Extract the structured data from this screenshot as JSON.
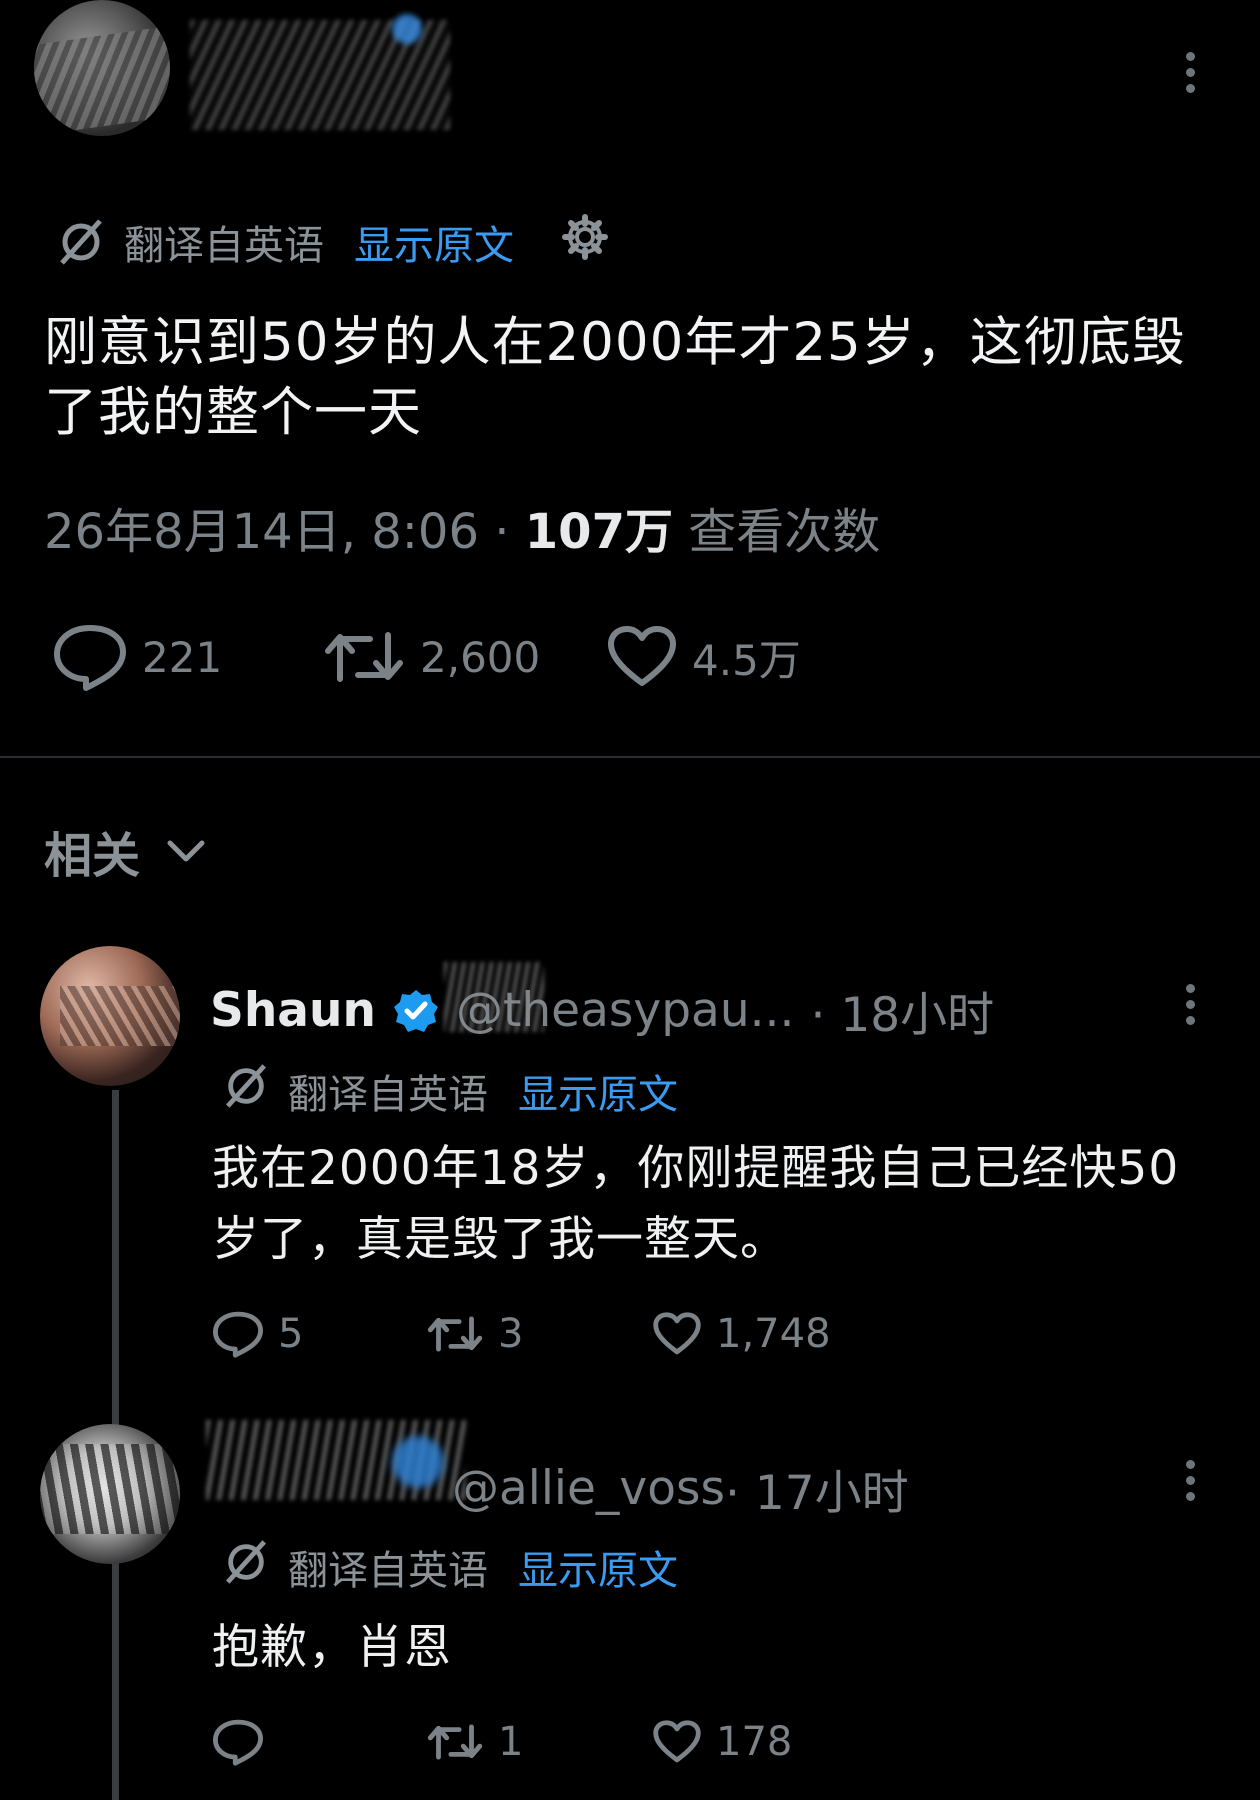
{
  "main_tweet": {
    "translate_label": "翻译自英语",
    "show_original": "显示原文",
    "text": "刚意识到50岁的人在2000年才25岁，这彻底毁了我的整个一天",
    "timestamp": "26年8月14日, 8:06 · ",
    "views_count": "107万",
    "views_label": " 查看次数",
    "replies": "221",
    "retweets": "2,600",
    "likes": "4.5万"
  },
  "related_label": "相关",
  "replies": [
    {
      "name": "Shaun",
      "handle": "@theasypau...",
      "time": " · 18小时",
      "translate_label": "翻译自英语",
      "show_original": "显示原文",
      "text": "我在2000年18岁，你刚提醒我自己已经快50岁了，真是毁了我一整天。",
      "replies": "5",
      "retweets": "3",
      "likes": "1,748"
    },
    {
      "name": "",
      "handle": "@allie_voss",
      "time": " · 17小时",
      "translate_label": "翻译自英语",
      "show_original": "显示原文",
      "text": "抱歉，肖恩",
      "replies": "",
      "retweets": "1",
      "likes": "178"
    }
  ],
  "colors": {
    "accent": "#3b9bf0",
    "verified": "#1d9bf0",
    "muted": "#7b8288",
    "background": "#000000"
  }
}
